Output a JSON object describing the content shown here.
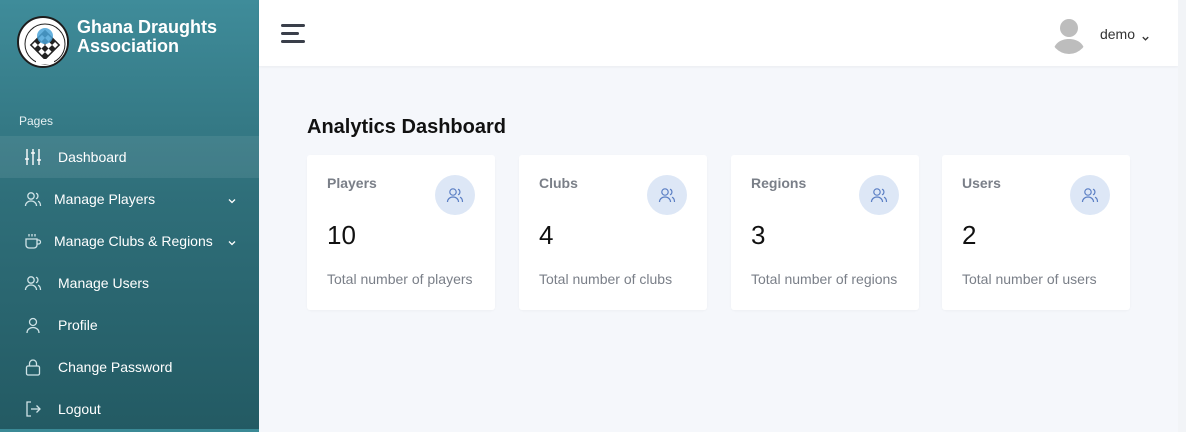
{
  "brand": {
    "name_line1": "Ghana Draughts",
    "name_line2": "Association"
  },
  "sidebar": {
    "section_label": "Pages",
    "items": [
      {
        "label": "Dashboard",
        "icon": "sliders-icon",
        "active": true
      },
      {
        "label": "Manage Players",
        "icon": "users-icon",
        "has_submenu": true
      },
      {
        "label": "Manage Clubs & Regions",
        "icon": "coffee-icon",
        "has_submenu": true
      },
      {
        "label": "Manage Users",
        "icon": "users-icon"
      },
      {
        "label": "Profile",
        "icon": "user-icon"
      },
      {
        "label": "Change Password",
        "icon": "lock-icon"
      },
      {
        "label": "Logout",
        "icon": "logout-icon"
      }
    ]
  },
  "header": {
    "user_name": "demo"
  },
  "page": {
    "title_bold": "Analytics",
    "title_rest": "Dashboard"
  },
  "cards": [
    {
      "title": "Players",
      "value": "10",
      "desc": "Total number of players"
    },
    {
      "title": "Clubs",
      "value": "4",
      "desc": "Total number of clubs"
    },
    {
      "title": "Regions",
      "value": "3",
      "desc": "Total number of regions"
    },
    {
      "title": "Users",
      "value": "2",
      "desc": "Total number of users"
    }
  ],
  "colors": {
    "sidebar_top": "#3f8c9a",
    "sidebar_bottom": "#235a63",
    "card_icon_bg": "#dde7f6",
    "card_icon": "#5b7fc4"
  }
}
